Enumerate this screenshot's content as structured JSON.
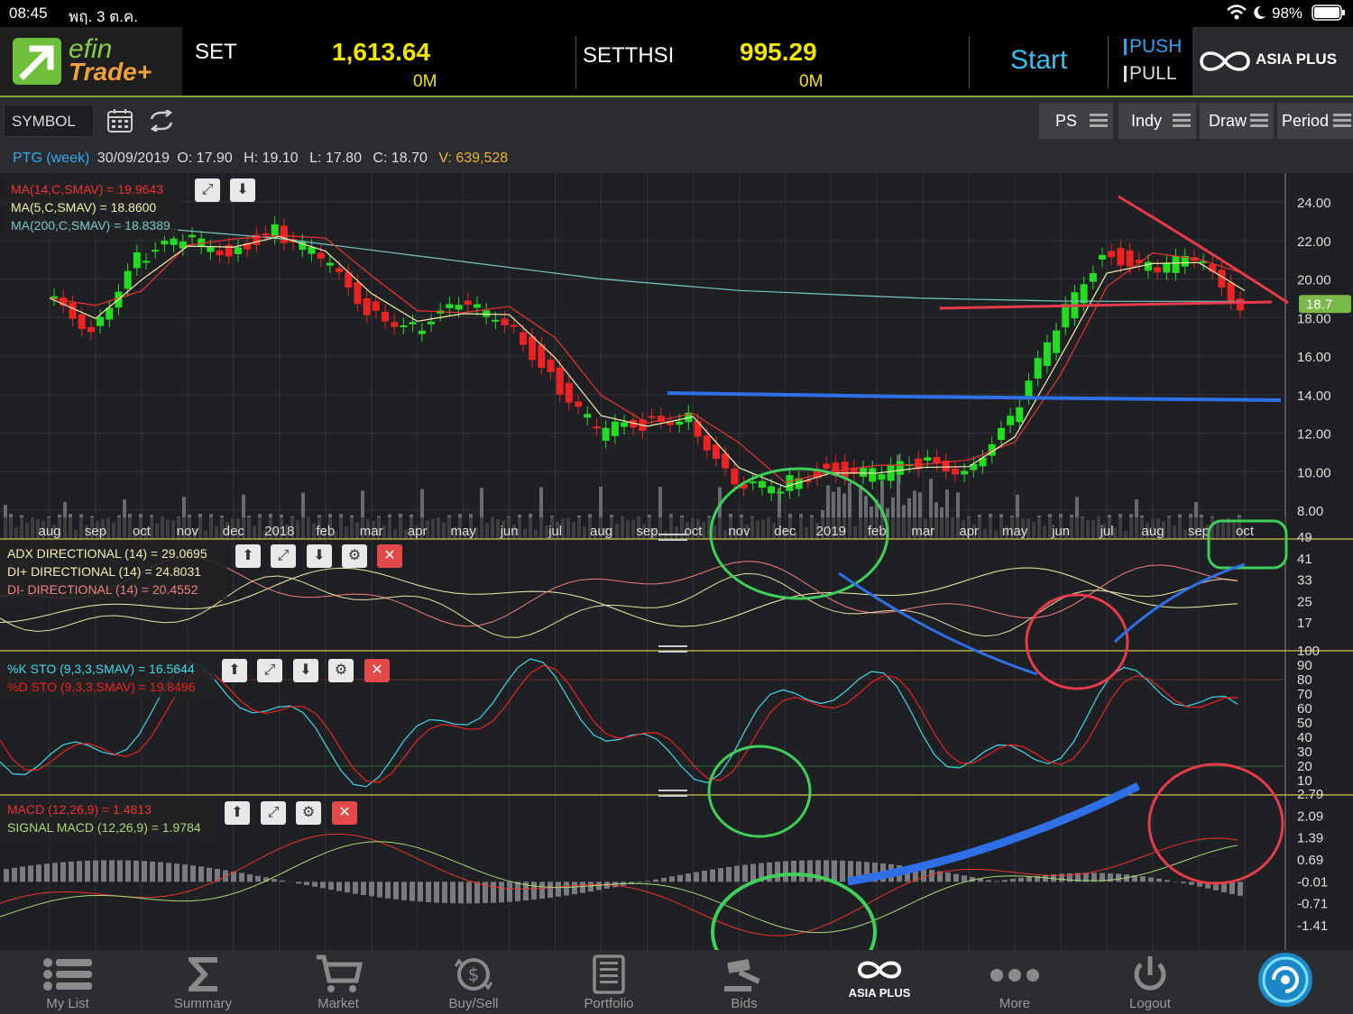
{
  "status": {
    "time": "08:45",
    "date": "พฤ. 3 ต.ค.",
    "battery": "98%"
  },
  "header": {
    "logo_top": "efin",
    "logo_bottom": "Trade+",
    "index1": {
      "name": "SET",
      "value": "1,613.64",
      "volume": "0M"
    },
    "index2": {
      "name": "SETTHSI",
      "value": "995.29",
      "volume": "0M"
    },
    "start_label": "Start",
    "push_label": "PUSH",
    "pull_label": "PULL",
    "broker": "ASIA PLUS"
  },
  "toolbar": {
    "symbol_label": "SYMBOL",
    "ps_label": "PS",
    "indy_label": "Indy",
    "draw_label": "Draw",
    "period_label": "Period"
  },
  "ohlc": {
    "symbol": "PTG (week)",
    "date": "30/09/2019",
    "o_label": "O:",
    "o": "17.90",
    "h_label": "H:",
    "h": "19.10",
    "l_label": "L:",
    "l": "17.80",
    "c_label": "C:",
    "c": "18.70",
    "v_label": "V:",
    "v": "639,528"
  },
  "price_panel": {
    "ma14": "MA(14,C,SMAV) = 19.9643",
    "ma5": "MA(5,C,SMAV) = 18.8600",
    "ma200": "MA(200,C,SMAV) = 18.8389",
    "y_ticks": [
      "24.00",
      "22.00",
      "20.00",
      "18.00",
      "16.00",
      "14.00",
      "12.00",
      "10.00",
      "8.00"
    ],
    "last_price": "18.7",
    "x_labels": [
      "aug",
      "sep",
      "oct",
      "nov",
      "dec",
      "2018",
      "feb",
      "mar",
      "apr",
      "may",
      "jun",
      "jul",
      "aug",
      "sep",
      "oct",
      "nov",
      "dec",
      "2019",
      "feb",
      "mar",
      "apr",
      "may",
      "jun",
      "jul",
      "aug",
      "sep",
      "oct"
    ]
  },
  "adx_panel": {
    "adx": "ADX DIRECTIONAL (14) = 29.0695",
    "di_plus": "DI+ DIRECTIONAL (14) = 24.8031",
    "di_minus": "DI- DIRECTIONAL (14) = 20.4552",
    "y_ticks": [
      "49",
      "41",
      "33",
      "25",
      "17"
    ]
  },
  "sto_panel": {
    "k": "%K STO (9,3,3,SMAV) = 16.5644",
    "d": "%D STO (9,3,3,SMAV) = 19.8496",
    "y_ticks": [
      "100",
      "90",
      "80",
      "70",
      "60",
      "50",
      "40",
      "30",
      "20",
      "10"
    ]
  },
  "macd_panel": {
    "macd": "MACD (12,26,9) = 1.4813",
    "signal": "SIGNAL MACD (12,26,9) = 1.9784",
    "y_ticks": [
      "2.79",
      "2.09",
      "1.39",
      "0.69",
      "-0.01",
      "-0.71",
      "-1.41"
    ]
  },
  "nav": [
    "My List",
    "Summary",
    "Market",
    "Buy/Sell",
    "Portfolio",
    "Bids",
    "",
    "More",
    "Logout"
  ],
  "nav_center_brand": "ASIA PLUS",
  "chart_data": {
    "type": "line",
    "title": "PTG (week)",
    "x": [
      "aug",
      "sep",
      "oct",
      "nov",
      "dec",
      "2018",
      "feb",
      "mar",
      "apr",
      "may",
      "jun",
      "jul",
      "aug",
      "sep",
      "oct",
      "nov",
      "dec",
      "2019",
      "feb",
      "mar",
      "apr",
      "may",
      "jun",
      "jul",
      "aug",
      "sep",
      "oct"
    ],
    "series": [
      {
        "name": "Close",
        "values": [
          19.0,
          17.5,
          21.0,
          22.0,
          21.5,
          22.5,
          21.0,
          18.5,
          17.5,
          18.5,
          18.0,
          15.0,
          12.0,
          12.5,
          13.0,
          9.0,
          9.3,
          10.2,
          9.8,
          10.4,
          10.2,
          12.5,
          17.5,
          21.5,
          20.5,
          21.0,
          18.7
        ]
      },
      {
        "name": "MA(200,C,SMAV)",
        "values": [
          22.8,
          22.8,
          22.7,
          22.5,
          22.3,
          22.1,
          21.8,
          21.5,
          21.2,
          20.9,
          20.6,
          20.3,
          20.0,
          19.8,
          19.6,
          19.4,
          19.3,
          19.2,
          19.1,
          19.0,
          18.95,
          18.9,
          18.85,
          18.84,
          18.84,
          18.84,
          18.84
        ]
      }
    ],
    "ylim": [
      7.5,
      24.5
    ]
  },
  "colors": {
    "up": "#22dd22",
    "down": "#ee2222",
    "ma14": "#ee3333",
    "ma5": "#f4f0b0",
    "ma200": "#7ac8c8",
    "accent": "#f2e600"
  }
}
